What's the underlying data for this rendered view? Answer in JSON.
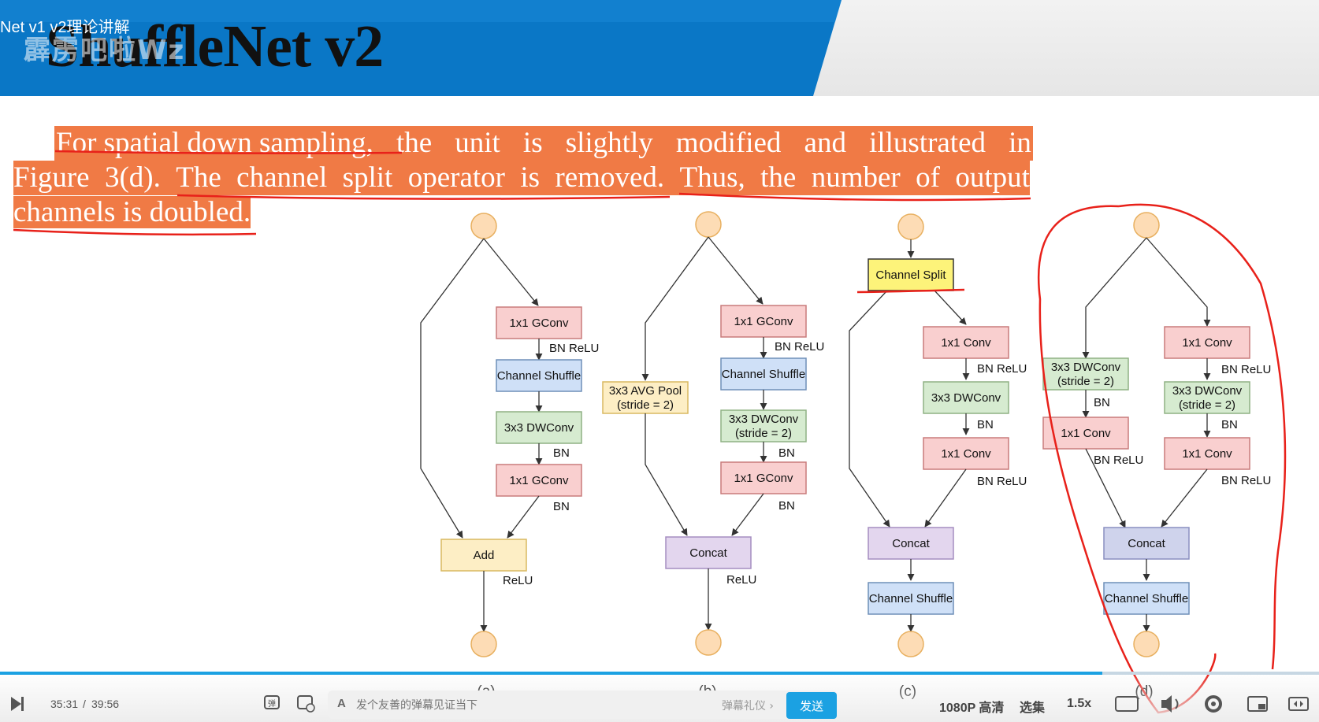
{
  "video": {
    "title": "Net v1 v2理论讲解",
    "watermark": "霹雳吧啦Wz"
  },
  "slide": {
    "title": "ShuffleNet v2",
    "paragraph": {
      "line1": [
        "For spatial down sampling,",
        "the",
        "unit",
        "is",
        "slightly",
        "modified",
        "and",
        "illustrated",
        "in"
      ],
      "line2": [
        "Figure",
        "3(d).",
        "The",
        "channel",
        "split",
        "operator",
        "is",
        "removed.",
        "Thus,",
        "the",
        "number",
        "of",
        "output"
      ],
      "line3": "channels is doubled."
    }
  },
  "diagram": {
    "a": {
      "caption": "(a)",
      "gconv1": "1x1 GConv",
      "bn_relu": "BN ReLU",
      "shuffle": "Channel Shuffle",
      "dwconv": "3x3 DWConv",
      "bn1": "BN",
      "gconv2": "1x1 GConv",
      "bn2": "BN",
      "add": "Add",
      "relu": "ReLU"
    },
    "b": {
      "caption": "(b)",
      "gconv1": "1x1 GConv",
      "bn_relu": "BN ReLU",
      "shuffle": "Channel Shuffle",
      "avgpool1": "3x3 AVG Pool",
      "avgpool2": "(stride = 2)",
      "dwconv1": "3x3 DWConv",
      "dwconv2": "(stride = 2)",
      "bn1": "BN",
      "gconv2": "1x1 GConv",
      "bn2": "BN",
      "concat": "Concat",
      "relu": "ReLU"
    },
    "c": {
      "caption": "(c)",
      "split": "Channel Split",
      "conv1": "1x1 Conv",
      "bn_relu1": "BN ReLU",
      "dwconv": "3x3 DWConv",
      "bn": "BN",
      "conv2": "1x1 Conv",
      "bn_relu2": "BN ReLU",
      "concat": "Concat",
      "shuffle": "Channel Shuffle"
    },
    "d": {
      "caption": "(d)",
      "l_dwconv1": "3x3 DWConv",
      "l_dwconv2": "(stride = 2)",
      "l_bn": "BN",
      "l_conv": "1x1 Conv",
      "l_bn_relu": "BN ReLU",
      "r_conv1": "1x1 Conv",
      "r_bn_relu1": "BN ReLU",
      "r_dwconv1": "3x3 DWConv",
      "r_dwconv2": "(stride = 2)",
      "r_bn": "BN",
      "r_conv2": "1x1 Conv",
      "r_bn_relu2": "BN ReLU",
      "concat": "Concat",
      "shuffle": "Channel Shuffle"
    }
  },
  "player": {
    "time_current": "35:31",
    "time_sep": "/",
    "time_total": "39:56",
    "progress": 0.889,
    "danmu_placeholder": "发个友善的弹幕见证当下",
    "danmu_gift": "弹幕礼仪 ›",
    "send": "发送",
    "quality": "1080P 高清",
    "episodes": "选集",
    "speed": "1.5x"
  },
  "colors": {
    "banner": "#0a77c6",
    "highlight": "#f07a45",
    "accent": "#1ba1e2",
    "pink": "#f9cfcf",
    "blue": "#cfe0f7",
    "green": "#d6ebd0",
    "yellow_box": "#fdeec5",
    "lavender": "#e3d6ee",
    "circle": "#fddcb5",
    "annotation": "#e8211a"
  }
}
